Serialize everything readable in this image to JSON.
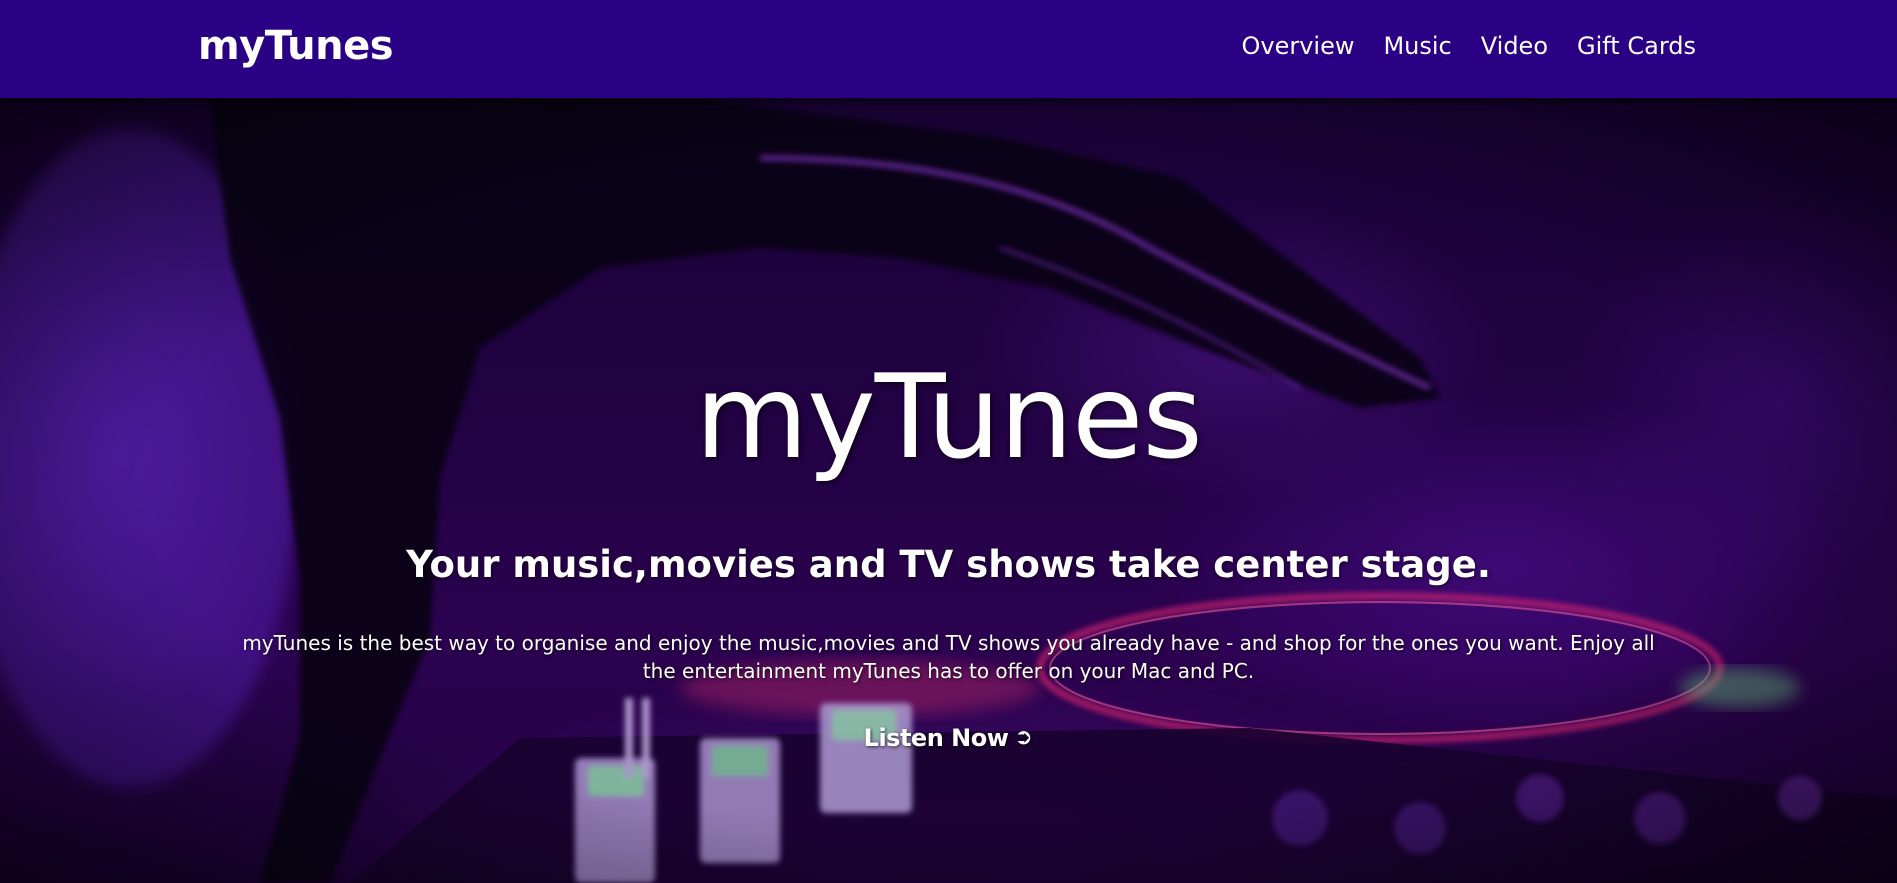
{
  "nav": {
    "brand": "myTunes",
    "links": [
      "Overview",
      "Music",
      "Video",
      "Gift Cards"
    ]
  },
  "hero": {
    "title": "myTunes",
    "subtitle": "Your music,movies and TV shows take center stage.",
    "description": "myTunes is the best way to organise and enjoy the music,movies and TV shows you already have - and shop for the ones you want. Enjoy all the entertainment myTunes has to offer on your Mac and PC.",
    "cta_label": "Listen Now",
    "cta_icon": "➲"
  },
  "colors": {
    "navbar": "#2a0085",
    "text": "#ffffff",
    "hero_tint": "#3a0a7a"
  }
}
